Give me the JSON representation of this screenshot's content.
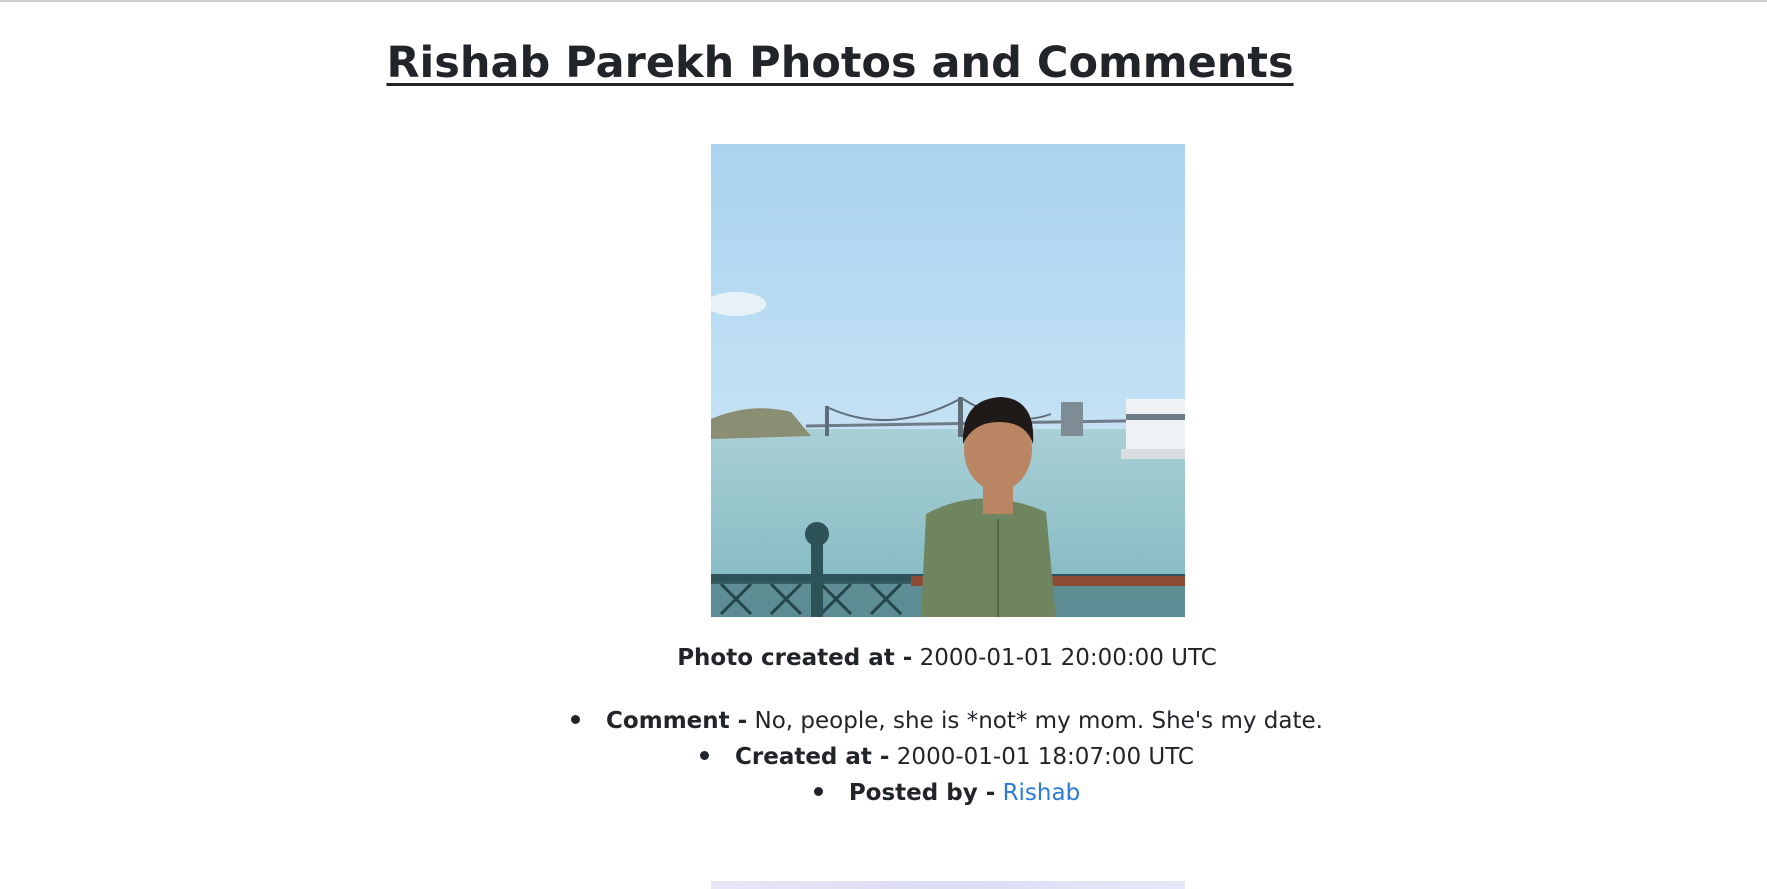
{
  "page": {
    "title": "Rishab Parekh Photos and Comments"
  },
  "photo": {
    "alt": "Photo of Rishab in front of a bridge",
    "created_label": "Photo created at -",
    "created_value": "2000-01-01 20:00:00 UTC"
  },
  "comment": {
    "comment_label": "Comment -",
    "comment_value": "No, people, she is *not* my mom. She's my date.",
    "created_label": "Created at -",
    "created_value": "2000-01-01 18:07:00 UTC",
    "posted_label": "Posted by -",
    "posted_value": "Rishab"
  },
  "colors": {
    "text": "#212529",
    "link": "#2a7bd9"
  }
}
